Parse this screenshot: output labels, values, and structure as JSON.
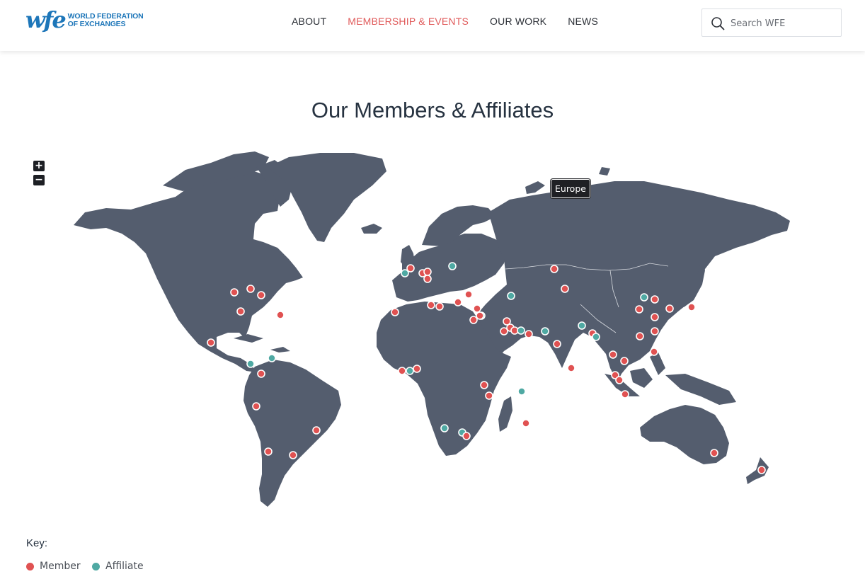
{
  "header": {
    "logo_mark": "wfe",
    "logo_line1": "WORLD FEDERATION",
    "logo_line2": "OF EXCHANGES",
    "nav": [
      "ABOUT",
      "MEMBERSHIP & EVENTS",
      "OUR WORK",
      "NEWS"
    ],
    "nav_active": "MEMBERSHIP & EVENTS",
    "search_placeholder": "Search WFE"
  },
  "title": "Our Members & Affiliates",
  "zoom": {
    "in": "+",
    "out": "−"
  },
  "tooltip": "Europe",
  "key": {
    "title": "Key:",
    "items": [
      {
        "label": "Member",
        "color": "#e05252"
      },
      {
        "label": "Affiliate",
        "color": "#4fa9a3"
      }
    ]
  },
  "colors": {
    "land": "#545d6e",
    "member": "#e05252",
    "affiliate": "#4fa9a3",
    "nav_active": "#e05a5a",
    "brand": "#1d76b9"
  }
}
